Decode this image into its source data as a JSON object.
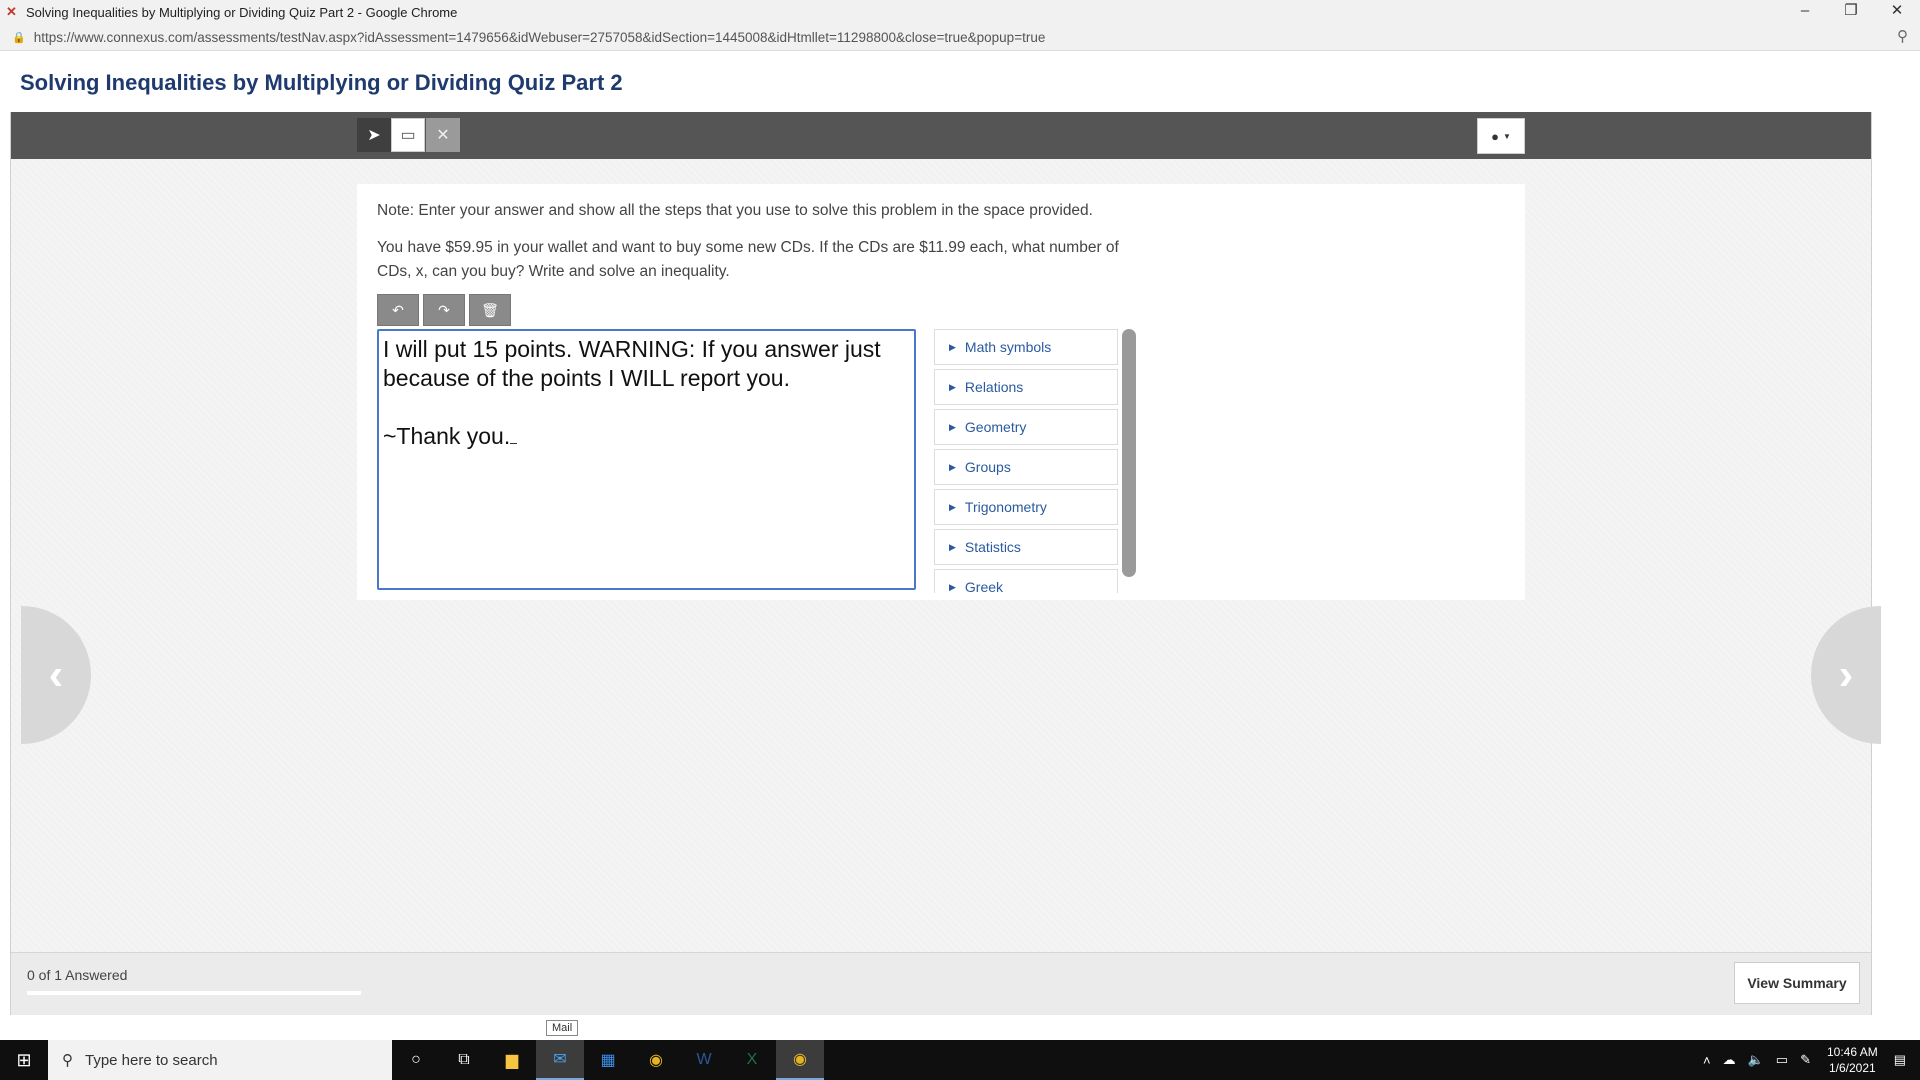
{
  "window": {
    "title": "Solving Inequalities by Multiplying or Dividing Quiz Part 2 - Google Chrome",
    "url": "https://www.connexus.com/assessments/testNav.aspx?idAssessment=1479656&idWebuser=2757058&idSection=1445008&idHtmllet=11298800&close=true&popup=true"
  },
  "page": {
    "title": "Solving Inequalities by Multiplying or Dividing Quiz Part 2"
  },
  "question": {
    "note": "Note: Enter your answer and show all the steps that you use to solve this problem in the space provided.",
    "text": "You have $59.95 in your wallet and want to buy some new CDs. If the CDs are $11.99 each, what number of CDs, x, can you buy? Write and solve an inequality."
  },
  "answer": {
    "line1": "I will put 15 points. WARNING: If you answer just because of the points I WILL report you.",
    "line2": "~Thank you."
  },
  "palette": {
    "items": [
      "Math symbols",
      "Relations",
      "Geometry",
      "Groups",
      "Trigonometry",
      "Statistics",
      "Greek"
    ]
  },
  "footer": {
    "answered": "0 of 1 Answered",
    "progress": 0,
    "view_summary": "View Summary"
  },
  "tooltip": "Mail",
  "taskbar": {
    "search_placeholder": "Type here to search",
    "time": "10:46 AM",
    "date": "1/6/2021"
  }
}
